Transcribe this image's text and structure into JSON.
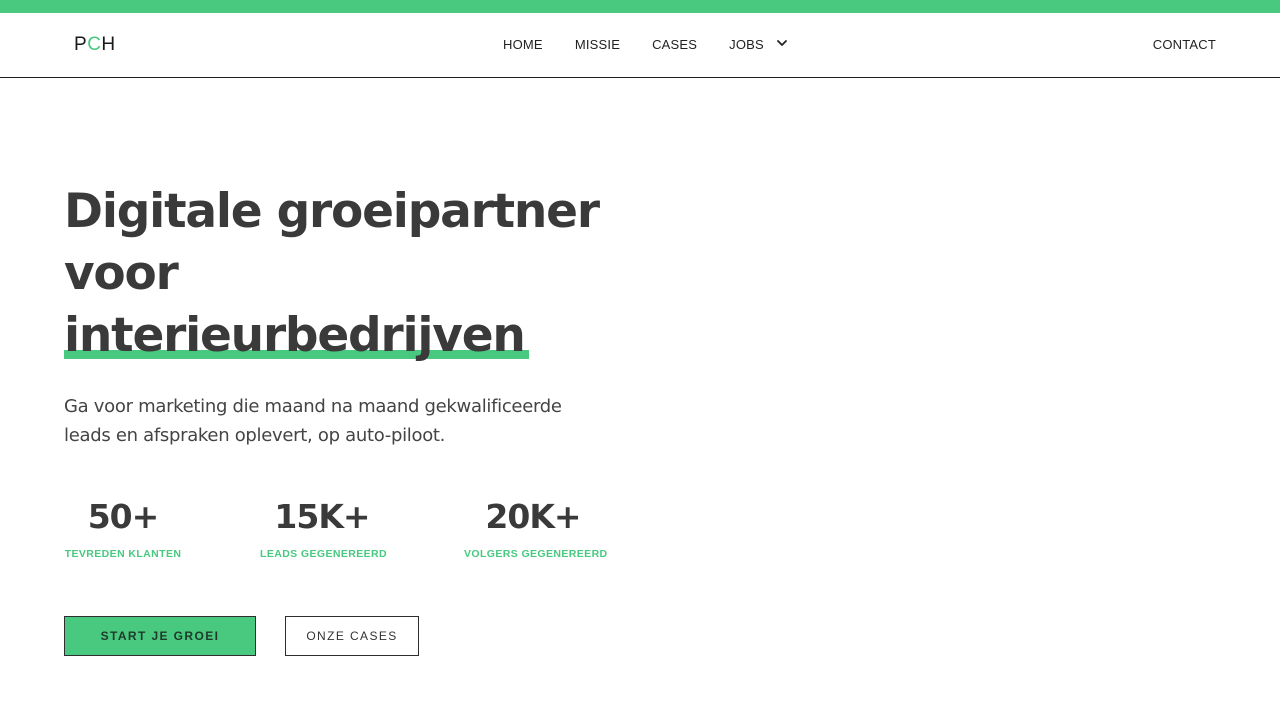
{
  "brand": {
    "logo_p": "P",
    "logo_c": "C",
    "logo_h": "H",
    "accent_color": "#48c97f"
  },
  "nav": {
    "items": [
      {
        "label": "HOME"
      },
      {
        "label": "MISSIE"
      },
      {
        "label": "CASES"
      },
      {
        "label": "JOBS",
        "icon": "chevron-down-icon"
      }
    ],
    "contact_label": "CONTACT"
  },
  "hero": {
    "title_line1": "Digitale groeipartner",
    "title_line2": "voor",
    "title_highlight": "interieurbedrijven",
    "subtitle": "Ga voor marketing die maand na maand gekwalificeerde leads en afspraken oplevert, op auto-piloot."
  },
  "stats": [
    {
      "number": "50+",
      "label": "TEVREDEN KLANTEN"
    },
    {
      "number": "15K+",
      "label": "LEADS GEGENEREERD"
    },
    {
      "number": "20K+",
      "label": "VOLGERS GEGENEREERD"
    }
  ],
  "cta": {
    "primary_label": "START JE GROEI",
    "secondary_label": "ONZE CASES"
  }
}
